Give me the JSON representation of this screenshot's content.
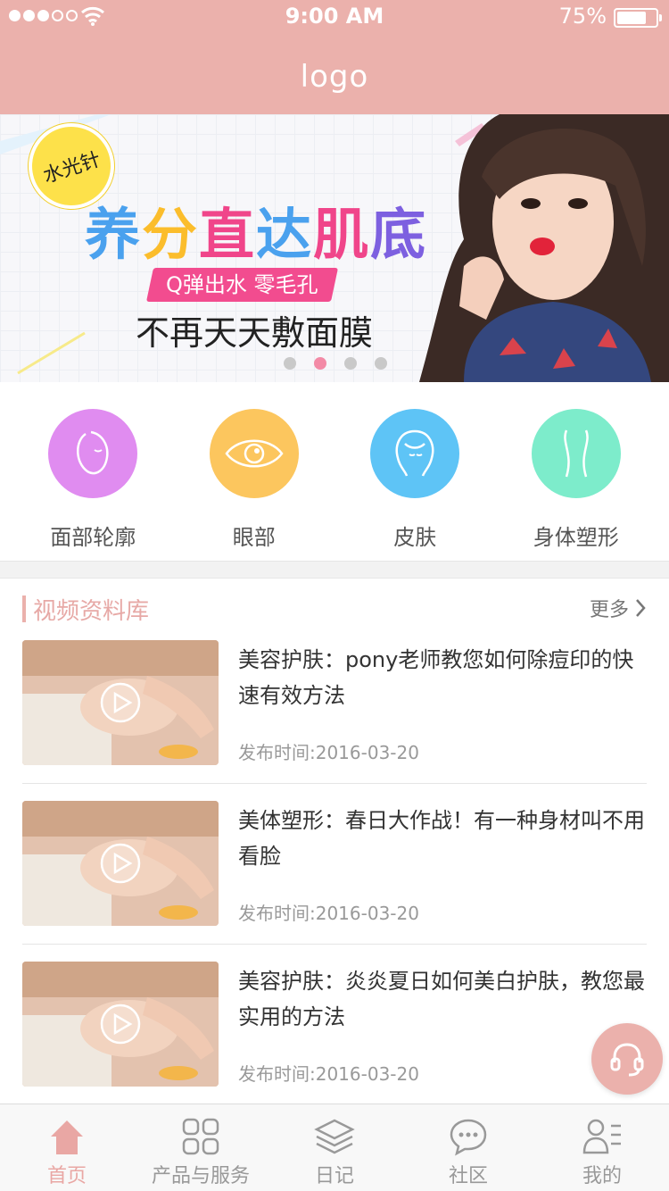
{
  "status_bar": {
    "time": "9:00 AM",
    "battery_percent": "75%",
    "battery_level": 0.75,
    "signal_bars_filled": 3,
    "signal_bars_total": 5
  },
  "header": {
    "logo_text": "logo"
  },
  "banner": {
    "badge": "水光针",
    "headline": [
      "养",
      "分",
      "直",
      "达",
      "肌",
      "底"
    ],
    "ribbon": "Q弹出水 零毛孔",
    "tagline": "不再天天敷面膜",
    "slide_count": 4,
    "active_slide": 2
  },
  "categories": [
    {
      "label": "面部轮廓",
      "icon": "face-contour-icon",
      "color": "#e08cf0"
    },
    {
      "label": "眼部",
      "icon": "eye-icon",
      "color": "#fcc65e"
    },
    {
      "label": "皮肤",
      "icon": "skin-icon",
      "color": "#5ec4f6"
    },
    {
      "label": "身体塑形",
      "icon": "body-shape-icon",
      "color": "#7deccb"
    }
  ],
  "video_section": {
    "title": "视频资料库",
    "more_label": "更多",
    "items": [
      {
        "title": "美容护肤：pony老师教您如何除痘印的快速有效方法",
        "date": "发布时间:2016-03-20"
      },
      {
        "title": "美体塑形：春日大作战！有一种身材叫不用看脸",
        "date": "发布时间:2016-03-20"
      },
      {
        "title": "美容护肤：炎炎夏日如何美白护肤，教您最实用的方法",
        "date": "发布时间:2016-03-20"
      }
    ]
  },
  "tabbar": {
    "tabs": [
      {
        "label": "首页",
        "icon": "home-icon",
        "active": true
      },
      {
        "label": "产品与服务",
        "icon": "grid-icon",
        "active": false
      },
      {
        "label": "日记",
        "icon": "layers-icon",
        "active": false
      },
      {
        "label": "社区",
        "icon": "chat-icon",
        "active": false
      },
      {
        "label": "我的",
        "icon": "profile-icon",
        "active": false
      }
    ]
  },
  "colors": {
    "brand": "#ebb1ac",
    "accent_pink": "#f24c8f",
    "active_tab": "#e9a7a4"
  }
}
